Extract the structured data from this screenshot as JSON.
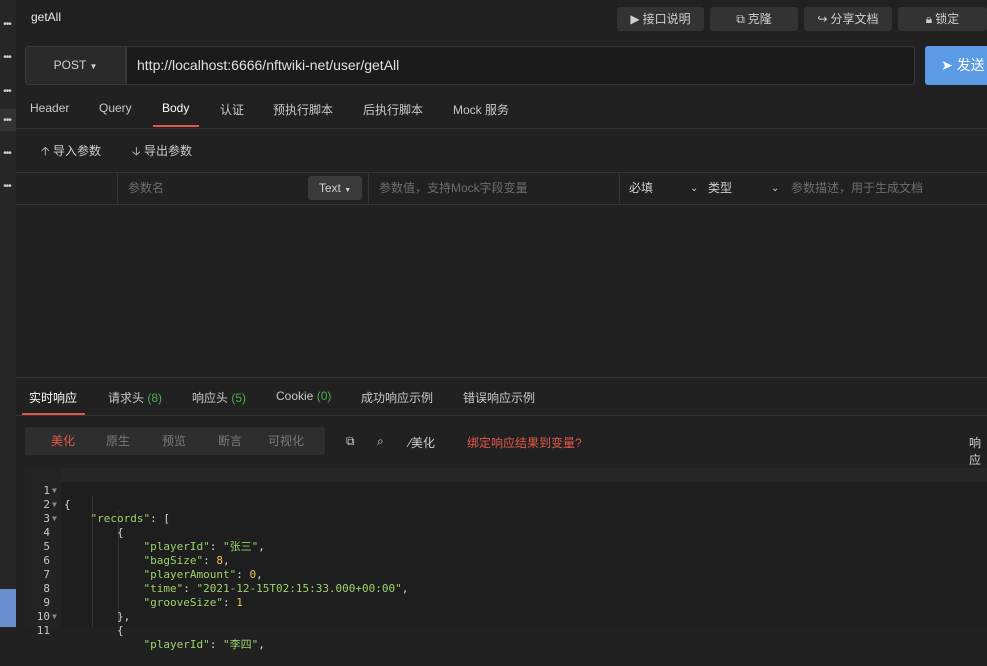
{
  "title": "getAll",
  "top_buttons": {
    "doc": "接口说明",
    "clone": "克隆",
    "share": "分享文档",
    "lock": "锁定"
  },
  "request": {
    "method": "POST",
    "url": "http://localhost:6666/nftwiki-net/user/getAll",
    "send": "发送"
  },
  "tabs": [
    "Header",
    "Query",
    "Body",
    "认证",
    "预执行脚本",
    "后执行脚本",
    "Mock 服务"
  ],
  "actions": {
    "import": "导入参数",
    "export": "导出参数"
  },
  "params": {
    "name_placeholder": "参数名",
    "type_button": "Text",
    "value_placeholder": "参数值，支持Mock字段变量",
    "required": "必填",
    "type": "类型",
    "desc_placeholder": "参数描述，用于生成文档"
  },
  "response_tabs": {
    "realtime": "实时响应",
    "req_headers": "请求头",
    "req_headers_count": "(8)",
    "resp_headers": "响应头",
    "resp_headers_count": "(5)",
    "cookie": "Cookie",
    "cookie_count": "(0)",
    "success_example": "成功响应示例",
    "error_example": "错误响应示例"
  },
  "view_modes": [
    "美化",
    "原生",
    "预览",
    "断言",
    "可视化"
  ],
  "tools": {
    "beautify": "美化",
    "bind": "绑定响应结果到变量?",
    "right": "响应"
  },
  "code_lines": [
    {
      "n": "1",
      "fold": true
    },
    {
      "n": "2",
      "fold": true
    },
    {
      "n": "3",
      "fold": true
    },
    {
      "n": "4",
      "fold": false
    },
    {
      "n": "5",
      "fold": false
    },
    {
      "n": "6",
      "fold": false
    },
    {
      "n": "7",
      "fold": false
    },
    {
      "n": "8",
      "fold": false
    },
    {
      "n": "9",
      "fold": false
    },
    {
      "n": "10",
      "fold": true
    },
    {
      "n": "11",
      "fold": false
    }
  ],
  "json": {
    "records_key": "\"records\"",
    "playerId_key": "\"playerId\"",
    "playerId_1": "\"张三\"",
    "bagSize_key": "\"bagSize\"",
    "bagSize_1": "8",
    "playerAmount_key": "\"playerAmount\"",
    "playerAmount_1": "0",
    "time_key": "\"time\"",
    "time_1": "\"2021-12-15T02:15:33.000+00:00\"",
    "grooveSize_key": "\"grooveSize\"",
    "grooveSize_1": "1",
    "playerId_2": "\"李四\""
  }
}
